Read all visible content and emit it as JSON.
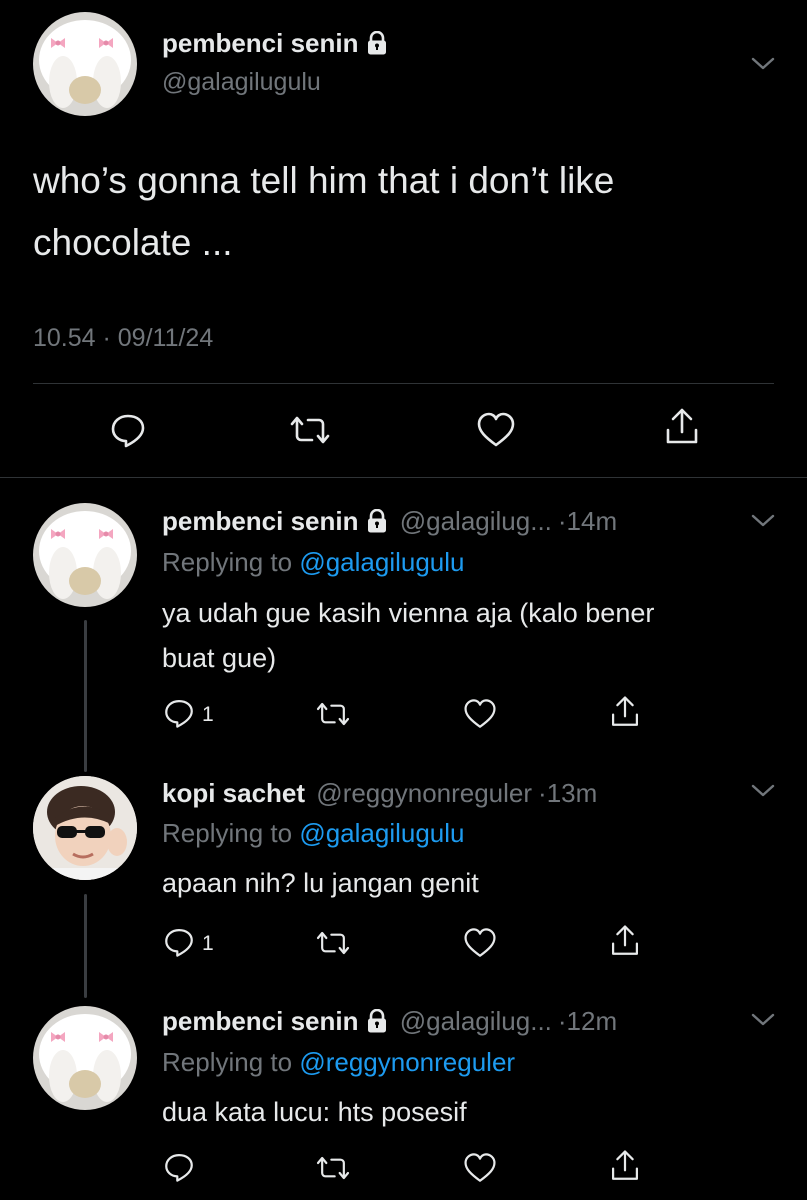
{
  "main_tweet": {
    "display_name": "pembenci senin",
    "handle": "@galagilugulu",
    "text_line1": "who’s gonna tell him that i don’t like",
    "text_line2": "chocolate ...",
    "timestamp": "10.54 · 09/11/24"
  },
  "replies": [
    {
      "display_name": "pembenci senin",
      "handle": "@galagilug...",
      "time": "·14m",
      "replying_prefix": "Replying to ",
      "replying_to": "@galagilugulu",
      "text_line1": "ya udah gue kasih vienna aja (kalo bener",
      "text_line2": "buat gue)",
      "reply_count": "1"
    },
    {
      "display_name": "kopi sachet",
      "handle": "@reggynonreguler",
      "time": "·13m",
      "replying_prefix": "Replying to ",
      "replying_to": "@galagilugulu",
      "text_line1": "apaan nih? lu jangan genit",
      "reply_count": "1"
    },
    {
      "display_name": "pembenci senin",
      "handle": "@galagilug...",
      "time": "·12m",
      "replying_prefix": "Replying to ",
      "replying_to": "@reggynonreguler",
      "text_line1": "dua kata lucu: hts posesif"
    }
  ],
  "colors": {
    "background": "#000000",
    "text": "#e7e9ea",
    "muted": "#71767b",
    "link": "#1d9bf0"
  }
}
